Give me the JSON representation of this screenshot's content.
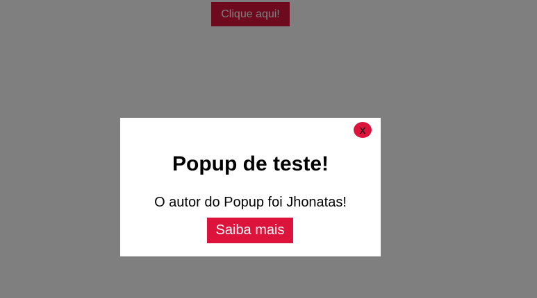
{
  "page": {
    "trigger_button_label": "Clique aqui!"
  },
  "popup": {
    "close_label": "x",
    "title": "Popup de teste!",
    "text": "O autor do Popup foi Jhonatas!",
    "more_button_label": "Saiba mais"
  },
  "colors": {
    "accent": "#dc143c",
    "overlay": "rgba(0,0,0,0.5)",
    "popup_background": "#ffffff"
  }
}
